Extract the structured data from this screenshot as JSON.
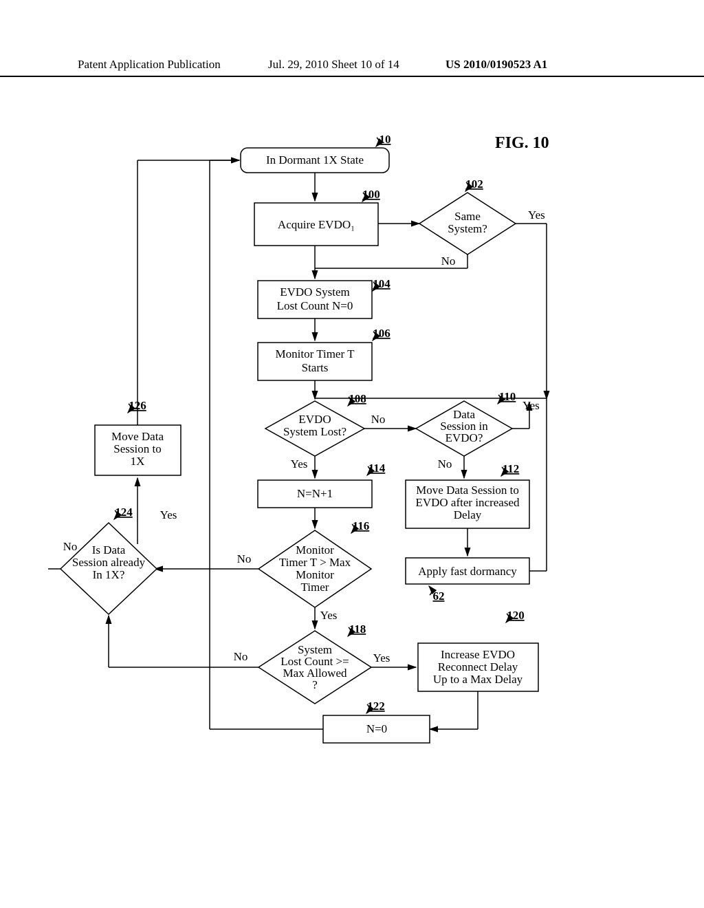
{
  "header": {
    "pub": "Patent Application Publication",
    "date": "Jul. 29, 2010  Sheet 10 of 14",
    "docnum": "US 2010/0190523 A1"
  },
  "fig": {
    "title": "FIG. 10"
  },
  "labels": {
    "yes": "Yes",
    "no": "No"
  },
  "refs": {
    "r10": "10",
    "r100": "100",
    "r102": "102",
    "r104": "104",
    "r106": "106",
    "r108": "108",
    "r110": "110",
    "r112": "112",
    "r114": "114",
    "r116": "116",
    "r118": "118",
    "r120": "120",
    "r122": "122",
    "r124": "124",
    "r126": "126",
    "r62": "62"
  },
  "nodes": {
    "b10": "In Dormant 1X State",
    "b100": "Acquire EVDO₁",
    "b102a": "Same",
    "b102b": "System?",
    "b104a": "EVDO System",
    "b104b": "Lost Count N=0",
    "b106a": "Monitor Timer T",
    "b106b": "Starts",
    "b108a": "EVDO",
    "b108b": "System Lost?",
    "b110a": "Data",
    "b110b": "Session in",
    "b110c": "EVDO?",
    "b112a": "Move Data Session to",
    "b112b": "EVDO after increased",
    "b112c": "Delay",
    "b114": "N=N+1",
    "b116a": "Monitor",
    "b116b": "Timer T > Max",
    "b116c": "Monitor",
    "b116d": "Timer",
    "b118a": "System",
    "b118b": "Lost Count >=",
    "b118c": "Max Allowed",
    "b118d": "?",
    "b120a": "Increase EVDO",
    "b120b": "Reconnect Delay",
    "b120c": "Up to a Max Delay",
    "b122": "N=0",
    "b124a": "Is Data",
    "b124b": "Session already",
    "b124c": "In 1X?",
    "b124d": "",
    "b126a": "Move Data",
    "b126b": "Session to",
    "b126c": "1X",
    "b62": "Apply fast dormancy"
  }
}
